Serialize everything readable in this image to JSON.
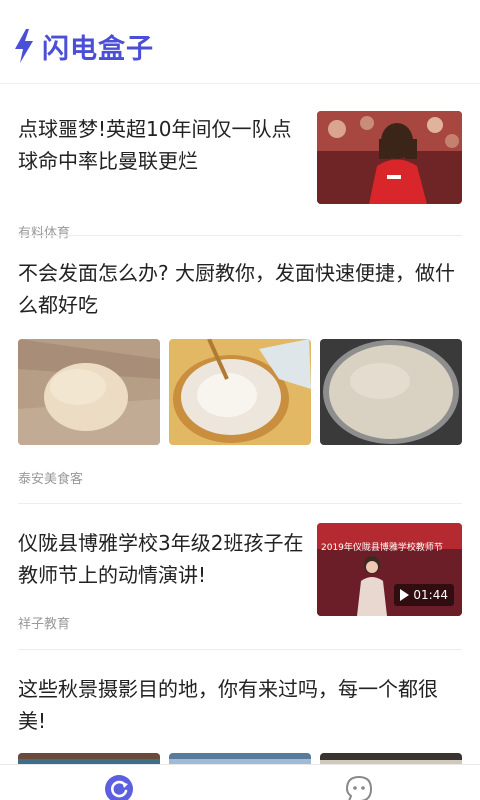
{
  "app": {
    "logo_text": "闪电盒子",
    "accent_color": "#4b4fd6"
  },
  "feed": {
    "articles": [
      {
        "title": "点球噩梦!英超10年间仅一队点球命中率比曼联更烂",
        "source": "有料体育"
      },
      {
        "title": "不会发面怎么办? 大厨教你，发面快速便捷，做什么都好吃",
        "source": "泰安美食客"
      },
      {
        "title": "仪陇县博雅学校3年级2班孩子在教师节上的动情演讲!",
        "source": "祥子教育",
        "video_duration": "01:44",
        "banner_text": "2019年仪陇县博雅学校教师节"
      },
      {
        "title": "这些秋景摄影目的地，你有来过吗，每一个都很美!"
      }
    ]
  },
  "bottom_nav": {
    "items": [
      {
        "icon": "refresh-icon",
        "active": true
      },
      {
        "icon": "chat-face-icon",
        "active": false
      }
    ]
  }
}
